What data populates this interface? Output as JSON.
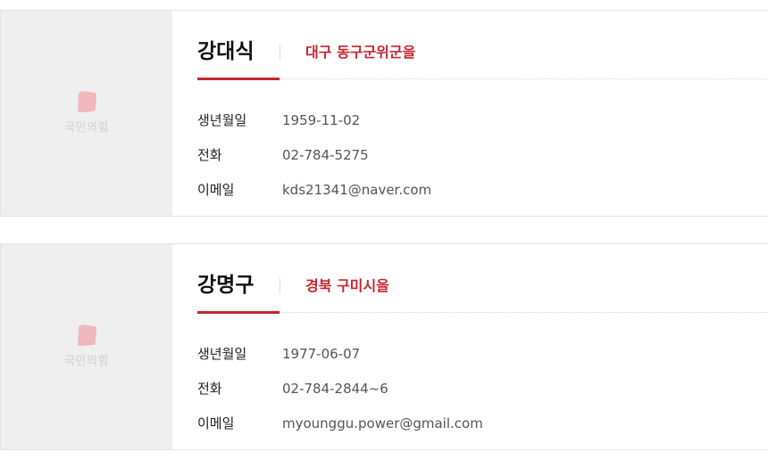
{
  "members": [
    {
      "party_logo_text": "국민의힘",
      "name": "강대식",
      "district": "대구 동구군위군을",
      "fields": [
        {
          "label": "생년월일",
          "value": "1959-11-02"
        },
        {
          "label": "전화",
          "value": "02-784-5275"
        },
        {
          "label": "이메일",
          "value": "kds21341@naver.com"
        }
      ]
    },
    {
      "party_logo_text": "국민의힘",
      "name": "강명구",
      "district": "경북 구미시을",
      "fields": [
        {
          "label": "생년월일",
          "value": "1977-06-07"
        },
        {
          "label": "전화",
          "value": "02-784-2844~6"
        },
        {
          "label": "이메일",
          "value": "myounggu.power@gmail.com"
        }
      ]
    }
  ],
  "colors": {
    "accent": "#c5262f",
    "photo_bg": "#efefef",
    "logo_mark": "#f0b8bc"
  },
  "icons": {
    "party_logo": "party-logo-icon"
  }
}
